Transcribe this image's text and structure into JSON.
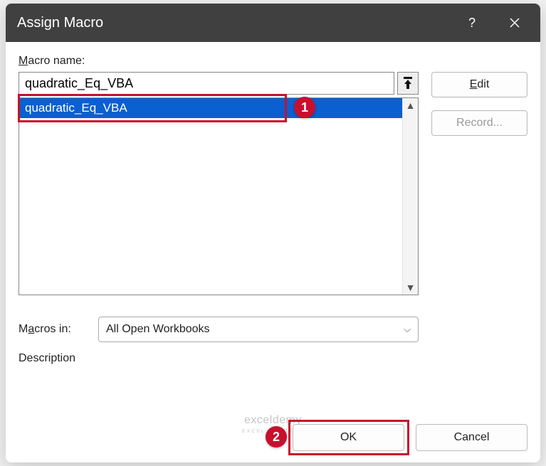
{
  "titlebar": {
    "title": "Assign Macro"
  },
  "labels": {
    "macro_name_prefix": "M",
    "macro_name_rest": "acro name:",
    "edit_prefix": "E",
    "edit_rest": "dit",
    "record": "Record...",
    "macros_in_prefix": "M",
    "macros_in_underline": "a",
    "macros_in_rest": "cros in:",
    "description": "Description",
    "ok": "OK",
    "cancel": "Cancel"
  },
  "macro_name_input": "quadratic_Eq_VBA",
  "macro_list": {
    "items": [
      {
        "label": "quadratic_Eq_VBA",
        "selected": true
      }
    ]
  },
  "macros_in_value": "All Open Workbooks",
  "callouts": {
    "badge1": "1",
    "badge2": "2"
  },
  "watermark": {
    "main": "exceldemy",
    "sub": "EXCEL & DATA BI"
  }
}
